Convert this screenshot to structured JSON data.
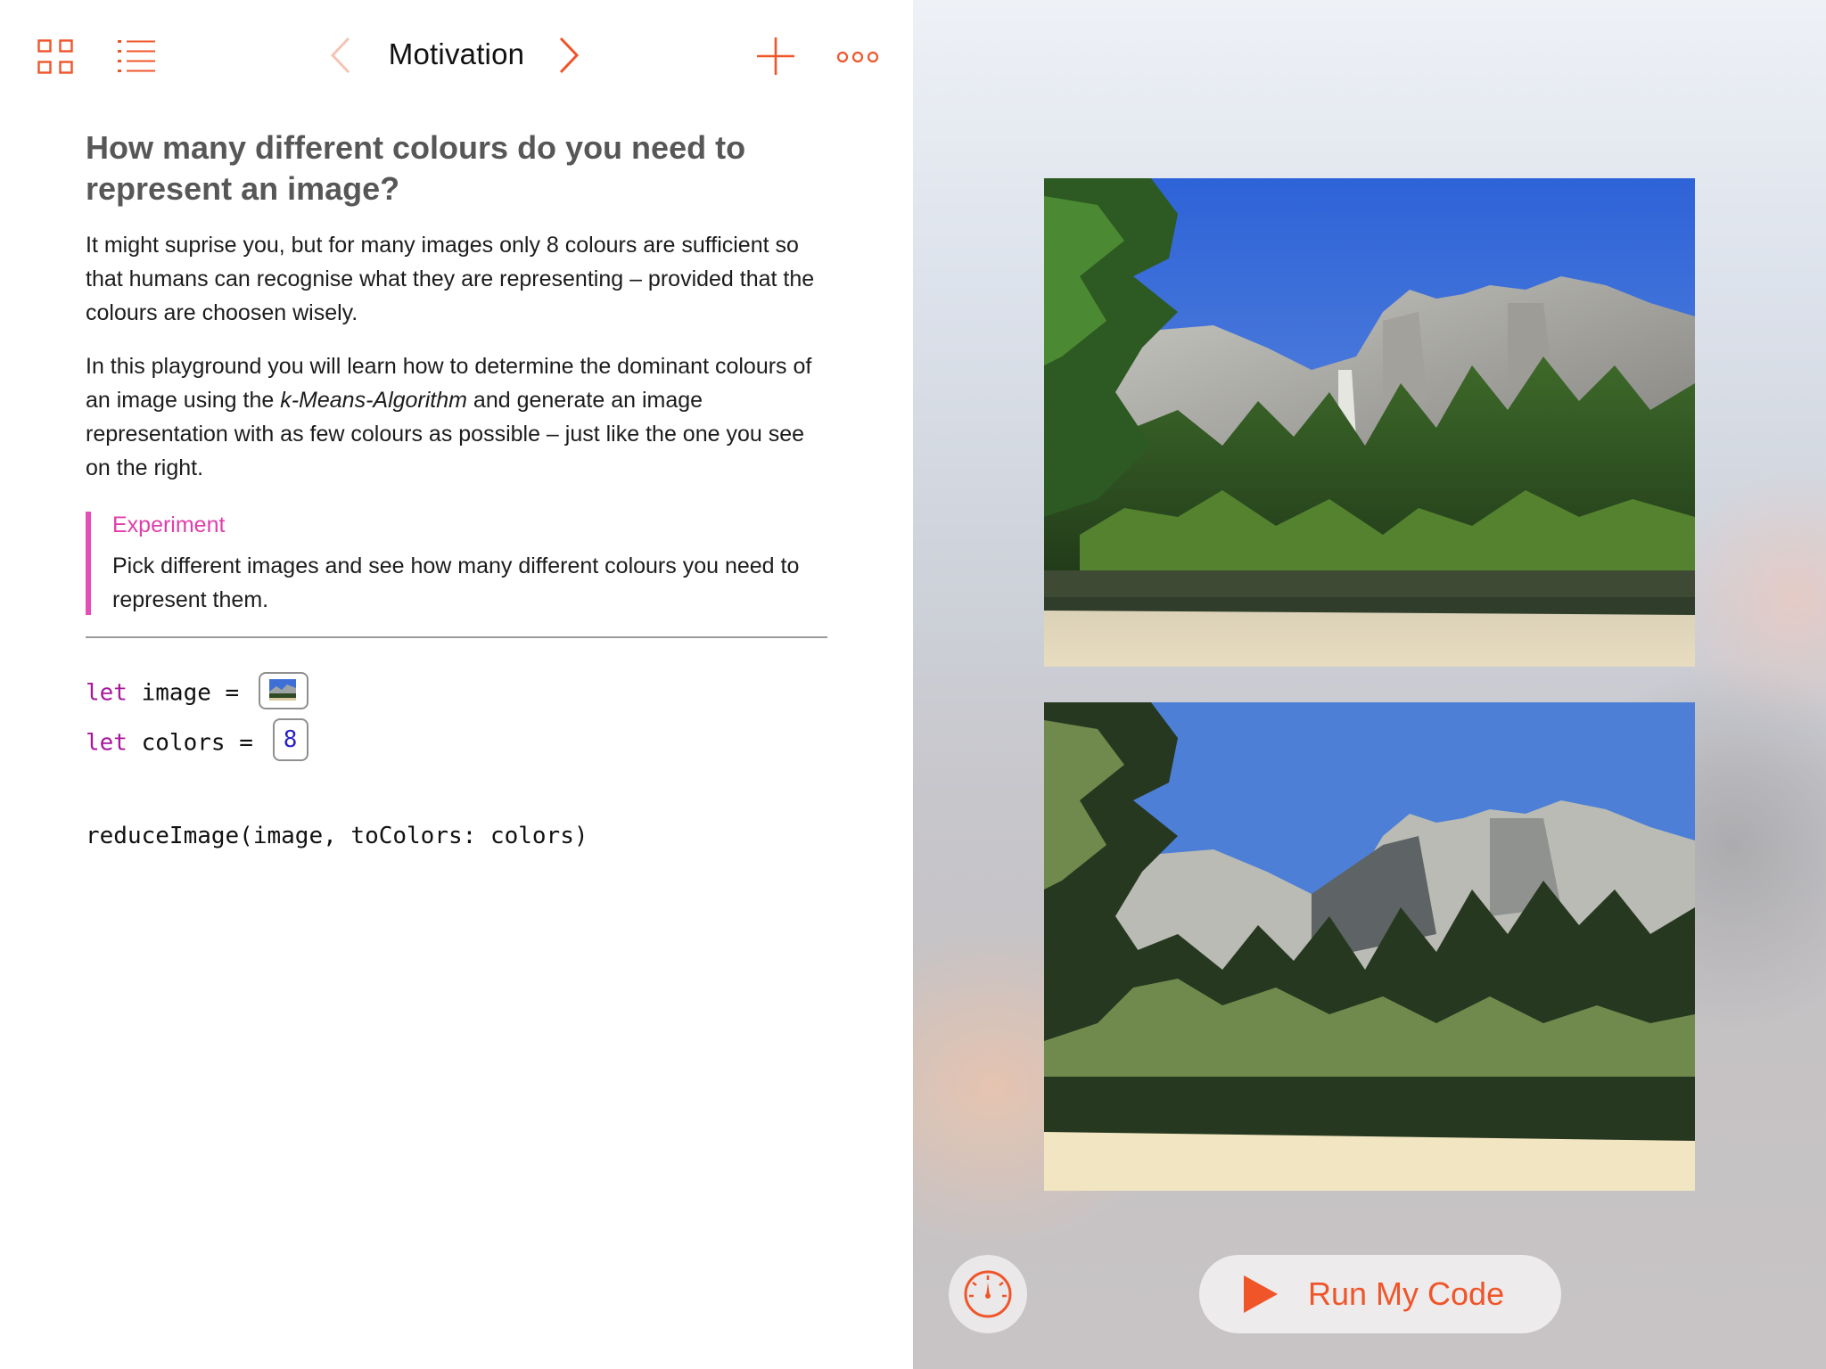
{
  "nav": {
    "title": "Motivation",
    "icons": [
      "grid-icon",
      "list-icon",
      "chevron-left-icon",
      "chevron-right-icon",
      "plus-icon",
      "more-icon"
    ]
  },
  "document": {
    "heading": "How many different colours do you need to represent an image?",
    "para1": "It might suprise you, but for many images only 8 colours are sufficient so that humans can recognise what they are representing – provided that the colours are choosen wisely.",
    "para2_before": "In this playground you will learn how to determine the dominant colours of an image using the ",
    "para2_emphasis": "k-Means-Algorithm",
    "para2_after": " and generate an image representation with as few colours as possible – just like the one you see on the right.",
    "callout": {
      "title": "Experiment",
      "body": "Pick different images and see how many different colours you need to represent them."
    }
  },
  "code": {
    "line1": {
      "keyword": "let",
      "rest": " image = "
    },
    "line2": {
      "keyword": "let",
      "rest": " colors = ",
      "value": "8"
    },
    "line3": "reduceImage(image, toColors: colors)"
  },
  "live_view": {
    "images": [
      "landscape-photo-original",
      "landscape-photo-reduced"
    ]
  },
  "controls": {
    "run_label": "Run My Code",
    "speed_icon": "speedometer-icon",
    "run_icon": "play-icon"
  },
  "colors": {
    "accent": "#f0552a",
    "callout": "#e54fb5",
    "keyword": "#a8189d",
    "number": "#2a22c8"
  }
}
